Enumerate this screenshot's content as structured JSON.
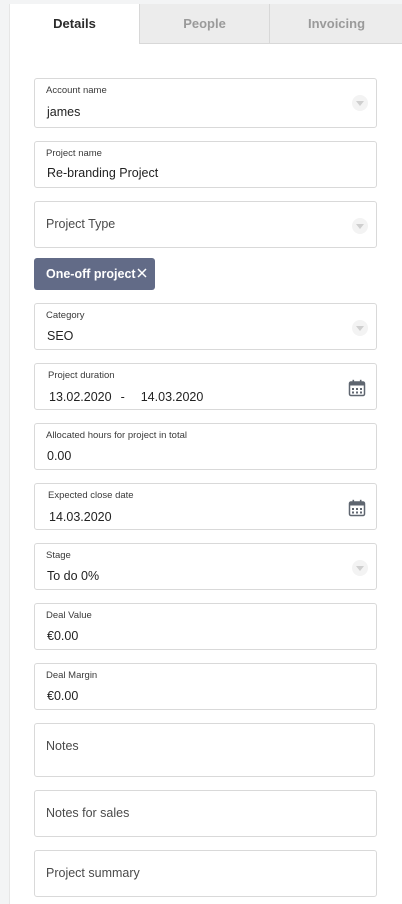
{
  "tabs": [
    {
      "label": "Details",
      "active": true
    },
    {
      "label": "People",
      "active": false
    },
    {
      "label": "Invoicing",
      "active": false
    }
  ],
  "form": {
    "account_name": {
      "label": "Account name",
      "value": "james"
    },
    "project_name": {
      "label": "Project name",
      "value": "Re-branding Project"
    },
    "project_type": {
      "placeholder": "Project Type"
    },
    "project_type_chip": {
      "label": "One-off project"
    },
    "category": {
      "label": "Category",
      "value": "SEO"
    },
    "project_duration": {
      "label": "Project duration",
      "start": "13.02.2020",
      "separator": "-",
      "end": "14.03.2020"
    },
    "allocated_hours": {
      "label": "Allocated hours for project in total",
      "value": "0.00"
    },
    "expected_close_date": {
      "label": "Expected close date",
      "value": "14.03.2020"
    },
    "stage": {
      "label": "Stage",
      "value": "To do 0%"
    },
    "deal_value": {
      "label": "Deal Value",
      "value": "€0.00"
    },
    "deal_margin": {
      "label": "Deal Margin",
      "value": "€0.00"
    },
    "notes": {
      "placeholder": "Notes"
    },
    "notes_for_sales": {
      "placeholder": "Notes for sales"
    },
    "project_summary": {
      "placeholder": "Project summary"
    }
  },
  "colors": {
    "chip_bg": "#626b87",
    "border": "#d9d9d9",
    "tab_inactive_bg": "#ececec"
  },
  "icons": [
    "chevron-down-icon",
    "calendar-icon",
    "close-icon"
  ]
}
